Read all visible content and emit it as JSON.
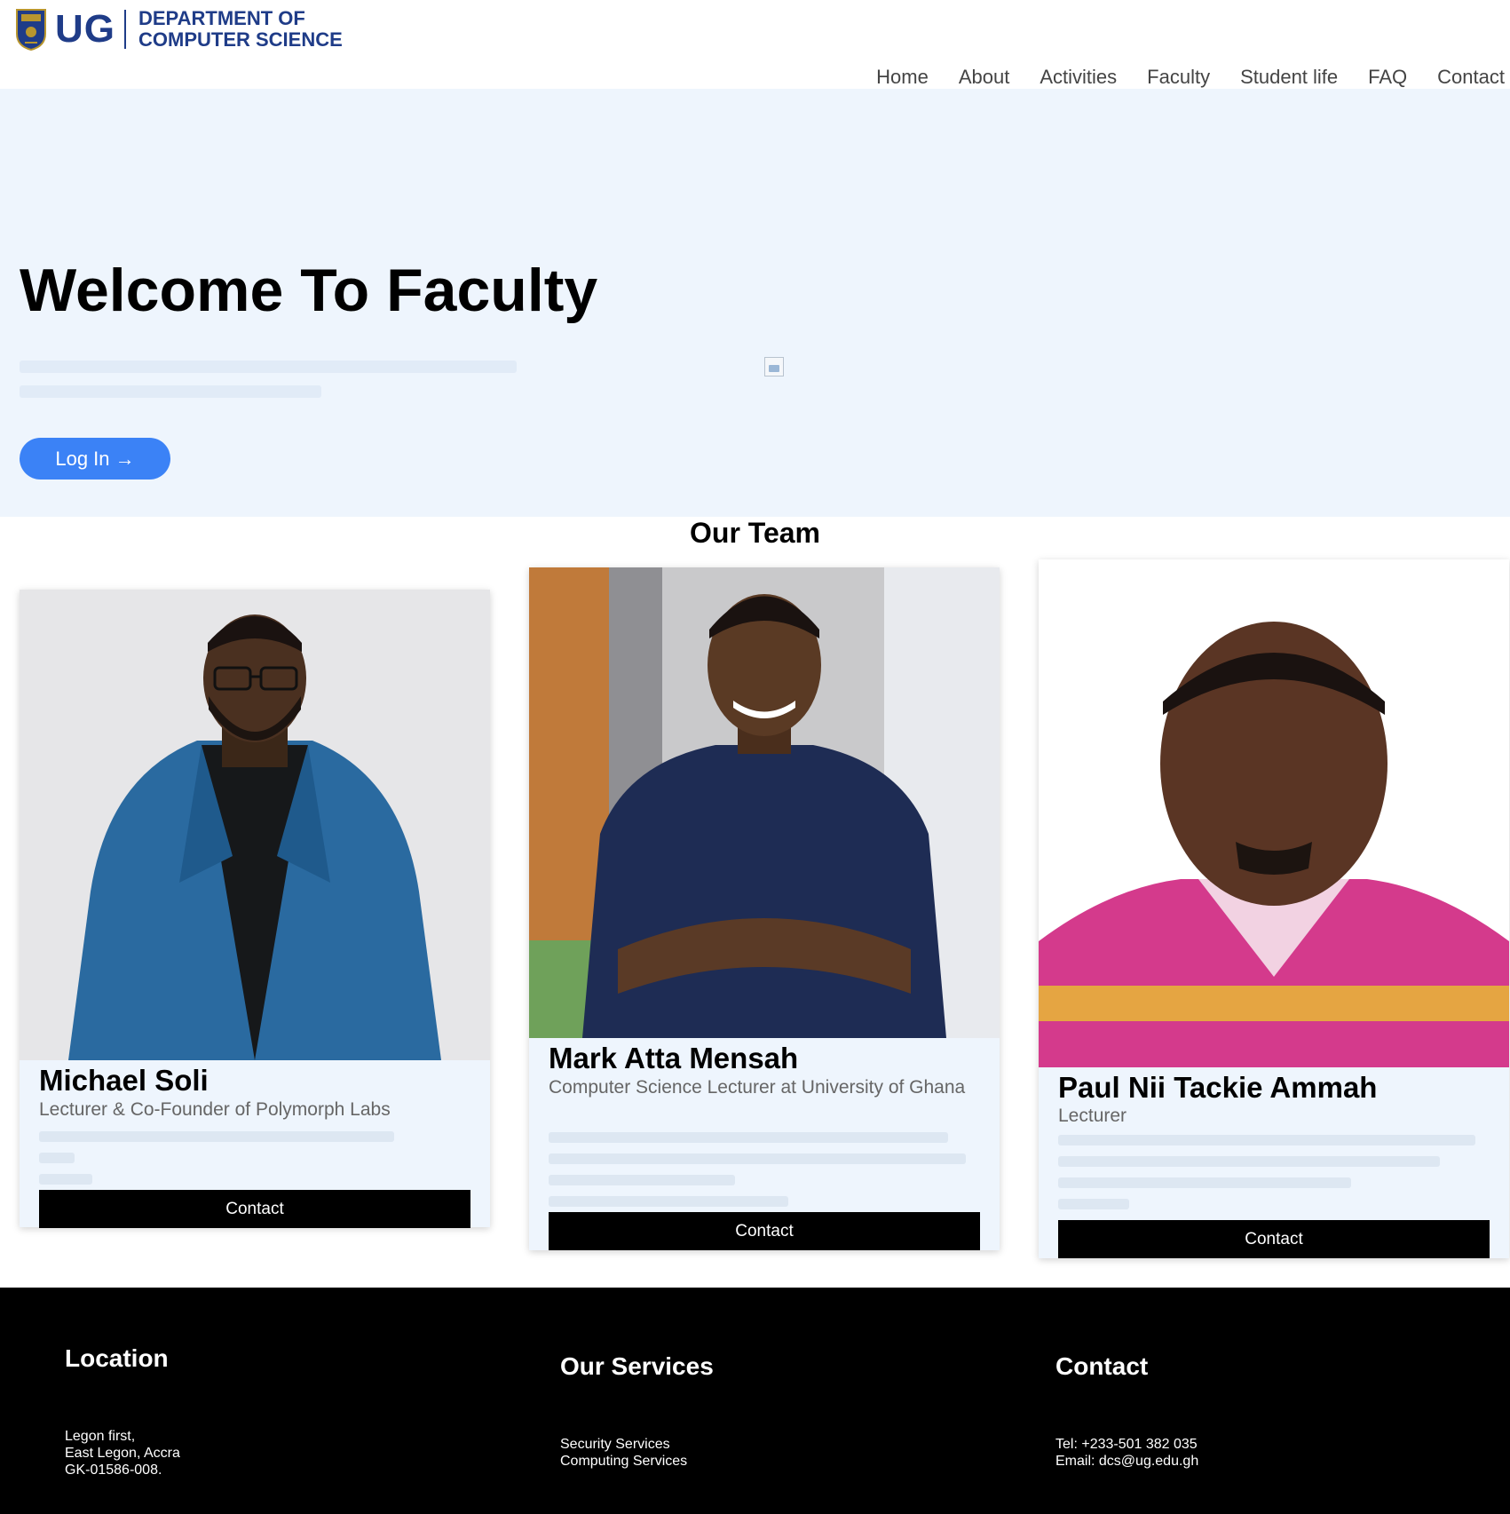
{
  "header": {
    "logo_text": "UG",
    "dept_line1": "DEPARTMENT OF",
    "dept_line2": "COMPUTER SCIENCE",
    "nav": [
      "Home",
      "About",
      "Activities",
      "Faculty",
      "Student life",
      "FAQ",
      "Contact"
    ]
  },
  "hero": {
    "title": "Welcome To Faculty",
    "login_label": "Log In →"
  },
  "team": {
    "title": "Our Team",
    "members": [
      {
        "name": "Michael Soli",
        "role": "Lecturer & Co-Founder of Polymorph Labs",
        "contact_label": "Contact"
      },
      {
        "name": "Mark Atta Mensah",
        "role": "Computer Science Lecturer at University of Ghana",
        "contact_label": "Contact"
      },
      {
        "name": "Paul Nii Tackie Ammah",
        "role": "Lecturer",
        "contact_label": "Contact"
      }
    ]
  },
  "footer": {
    "location": {
      "title": "Location",
      "lines": [
        "Legon first,",
        "East Legon, Accra",
        "GK-01586-008."
      ]
    },
    "services": {
      "title": "Our Services",
      "lines": [
        "Security Services",
        "Computing Services"
      ]
    },
    "contact": {
      "title": "Contact",
      "lines": [
        "Tel: +233-501 382 035",
        "Email: dcs@ug.edu.gh"
      ]
    }
  },
  "colors": {
    "brand": "#1f3c88",
    "hero_bg": "#eef5fd",
    "login_button": "#3b82f6",
    "contact_button": "#000000",
    "footer_bg": "#000000"
  }
}
